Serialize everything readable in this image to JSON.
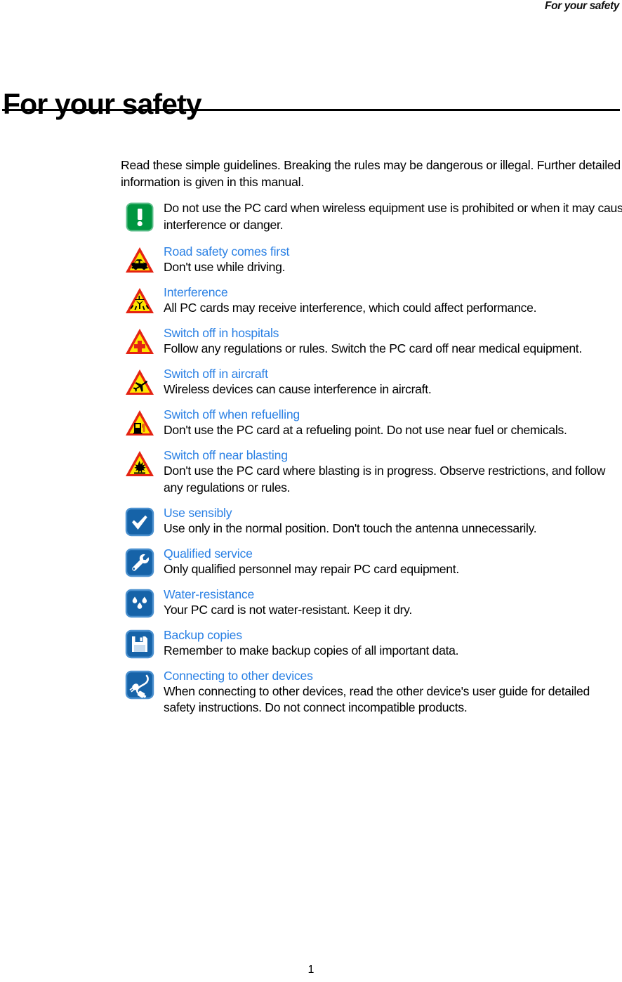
{
  "header": {
    "running_head": "For your safety"
  },
  "title": "For your safety",
  "intro": "Read these simple guidelines. Breaking the rules may be dangerous or illegal. Further detailed information is given in this manual.",
  "guidelines": [
    {
      "icon": "green-exclamation-icon",
      "title": "",
      "text": "Do not use the PC card when wireless equipment use is prohibited or when it may cause interference or danger."
    },
    {
      "icon": "car-warning-icon",
      "title": "Road safety comes first",
      "text": "Don't use while driving."
    },
    {
      "icon": "interference-warning-icon",
      "title": "Interference",
      "text": "All PC cards may receive interference, which could affect performance."
    },
    {
      "icon": "hospital-cross-warning-icon",
      "title": "Switch off in hospitals",
      "text": "Follow any regulations or rules. Switch the PC card off near medical equipment."
    },
    {
      "icon": "aircraft-warning-icon",
      "title": "Switch off in aircraft",
      "text": "Wireless devices can cause interference in aircraft."
    },
    {
      "icon": "fuel-pump-warning-icon",
      "title": "Switch off when refuelling",
      "text": "Don't use the PC card at a refueling point. Do not use near fuel or chemicals."
    },
    {
      "icon": "blasting-warning-icon",
      "title": "Switch off near blasting",
      "text": "Don't use the PC card where blasting is in progress. Observe restrictions, and follow any regulations or rules."
    },
    {
      "icon": "checkmark-icon",
      "title": "Use sensibly",
      "text": "Use only in the normal position. Don't touch the antenna unnecessarily."
    },
    {
      "icon": "wrench-icon",
      "title": "Qualified service",
      "text": "Only qualified personnel may repair PC card equipment."
    },
    {
      "icon": "water-drops-icon",
      "title": "Water-resistance",
      "text": "Your PC card is not water-resistant. Keep it dry."
    },
    {
      "icon": "floppy-disk-icon",
      "title": "Backup copies",
      "text": "Remember to make backup copies of all important data."
    },
    {
      "icon": "plug-cable-icon",
      "title": "Connecting to other devices",
      "text": "When connecting to other devices, read the other device's user guide for detailed safety instructions. Do not connect incompatible products."
    }
  ],
  "page_number": "1",
  "colors": {
    "heading_blue": "#2a80e4",
    "warning_yellow": "#ffe500",
    "warning_red": "#e42313",
    "icon_green": "#009640",
    "icon_blue": "#1663a8",
    "icon_blue_border": "#4a90cf",
    "text_black": "#000000"
  }
}
